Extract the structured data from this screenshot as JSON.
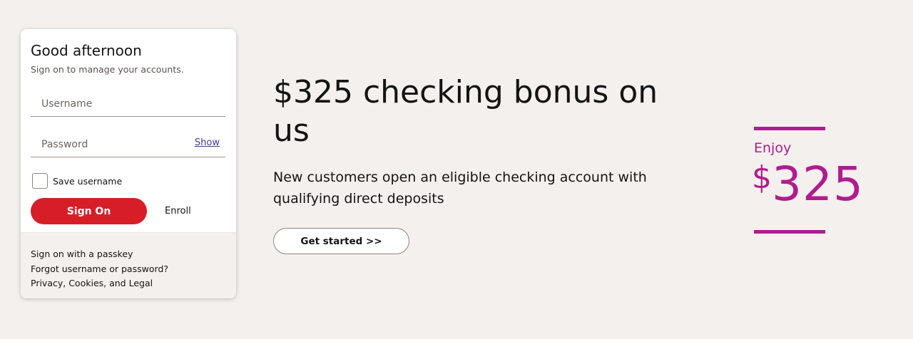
{
  "signon": {
    "greeting": "Good afternoon",
    "subtitle": "Sign on to manage your accounts.",
    "username_placeholder": "Username",
    "password_placeholder": "Password",
    "show_label": "Show",
    "save_username_label": "Save username",
    "save_username_checked": false,
    "sign_on_label": "Sign On",
    "enroll_label": "Enroll",
    "footer_links": [
      "Sign on with a passkey",
      "Forgot username or password?",
      "Privacy, Cookies, and Legal"
    ]
  },
  "hero": {
    "title": "$325 checking bonus on us",
    "description": "New customers open an eligible checking account with qualifying direct deposits",
    "cta_label": "Get started >>"
  },
  "promo": {
    "enjoy": "Enjoy",
    "currency": "$",
    "amount": "325"
  },
  "colors": {
    "background": "#f3f0ed",
    "sign_on_button": "#d71e28",
    "promo_accent": "#b01c8f",
    "link": "#3a3f8f"
  }
}
